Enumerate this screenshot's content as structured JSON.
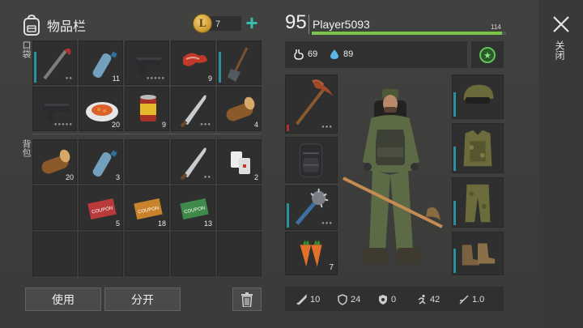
{
  "inventory": {
    "title": "物品栏",
    "coins": "7",
    "pocket_label": "口袋",
    "backpack_label": "背包",
    "pocket_slots": [
      {
        "item": "crowbar",
        "count": "",
        "dots": "●●"
      },
      {
        "item": "water-bottle",
        "count": "11",
        "dots": ""
      },
      {
        "item": "pistol",
        "count": "",
        "dots": "●●●●●"
      },
      {
        "item": "raw-meat",
        "count": "9",
        "dots": ""
      },
      {
        "item": "shovel",
        "count": "",
        "dots": ""
      },
      {
        "item": "pistol",
        "count": "",
        "dots": "●●●●●"
      },
      {
        "item": "cooked-dish",
        "count": "20",
        "dots": ""
      },
      {
        "item": "canned-food",
        "count": "9",
        "dots": ""
      },
      {
        "item": "machete",
        "count": "",
        "dots": "●●●"
      },
      {
        "item": "log",
        "count": "4",
        "dots": ""
      }
    ],
    "backpack_slots": [
      {
        "item": "log",
        "count": "20",
        "dots": ""
      },
      {
        "item": "water-bottle",
        "count": "3",
        "dots": ""
      },
      {
        "item": "empty",
        "count": "",
        "dots": ""
      },
      {
        "item": "machete",
        "count": "",
        "dots": "●●"
      },
      {
        "item": "bandage",
        "count": "2",
        "dots": ""
      },
      {
        "item": "empty",
        "count": "",
        "dots": ""
      },
      {
        "item": "coupon-red",
        "count": "5",
        "dots": ""
      },
      {
        "item": "coupon-orange",
        "count": "18",
        "dots": ""
      },
      {
        "item": "coupon-green",
        "count": "13",
        "dots": ""
      },
      {
        "item": "empty",
        "count": "",
        "dots": ""
      },
      {
        "item": "empty",
        "count": "",
        "dots": ""
      },
      {
        "item": "empty",
        "count": "",
        "dots": ""
      },
      {
        "item": "empty",
        "count": "",
        "dots": ""
      },
      {
        "item": "empty",
        "count": "",
        "dots": ""
      },
      {
        "item": "empty",
        "count": "",
        "dots": ""
      }
    ],
    "use_label": "使用",
    "split_label": "分开"
  },
  "player": {
    "level": "95",
    "name": "Player5093",
    "xp_max": "114",
    "xp_fraction": 0.98,
    "food": "69",
    "water": "89",
    "equipment": {
      "weapon": {
        "item": "pickaxe",
        "dots": "●●●"
      },
      "backpack": {
        "item": "backpack"
      },
      "melee": {
        "item": "spiked-club",
        "dots": "●●●"
      },
      "consumable": {
        "item": "carrots",
        "count": "7"
      },
      "head": {
        "item": "helmet-goggles"
      },
      "body": {
        "item": "camo-vest"
      },
      "legs": {
        "item": "camo-pants"
      },
      "feet": {
        "item": "boots"
      }
    },
    "stats": {
      "attack": "10",
      "defense": "24",
      "radiation": "0",
      "speed": "42",
      "stealth": "1.0"
    }
  },
  "close_label": "关闭",
  "colors": {
    "accent": "#39c0b0",
    "xp_bar": "#7bc54a",
    "durability": "#2a8fa0",
    "perk": "#5fc45a"
  }
}
